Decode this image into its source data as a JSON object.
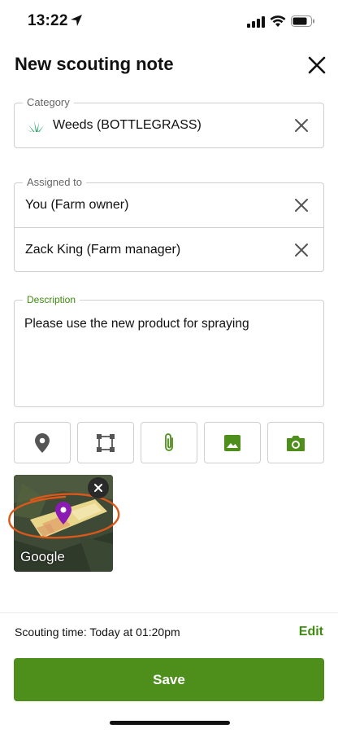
{
  "status": {
    "time": "13:22"
  },
  "header": {
    "title": "New scouting note"
  },
  "category": {
    "legend": "Category",
    "value": "Weeds (BOTTLEGRASS)",
    "icon": "grass-icon"
  },
  "assigned": {
    "legend": "Assigned to",
    "items": [
      {
        "label": "You (Farm owner)"
      },
      {
        "label": "Zack King (Farm manager)"
      }
    ]
  },
  "description": {
    "legend": "Description",
    "value": "Please use the new product for spraying"
  },
  "tools": [
    {
      "icon": "location-pin-icon"
    },
    {
      "icon": "area-select-icon"
    },
    {
      "icon": "paperclip-icon"
    },
    {
      "icon": "image-icon"
    },
    {
      "icon": "camera-icon"
    }
  ],
  "map_thumbnail": {
    "label": "Google"
  },
  "footer": {
    "scouting_time": "Scouting time: Today at 01:20pm",
    "edit_label": "Edit",
    "save_label": "Save"
  },
  "colors": {
    "accent": "#4e8e1a",
    "accent_text": "#3f8a10",
    "pin": "#8a1bb3",
    "annotation": "#d9581b"
  }
}
